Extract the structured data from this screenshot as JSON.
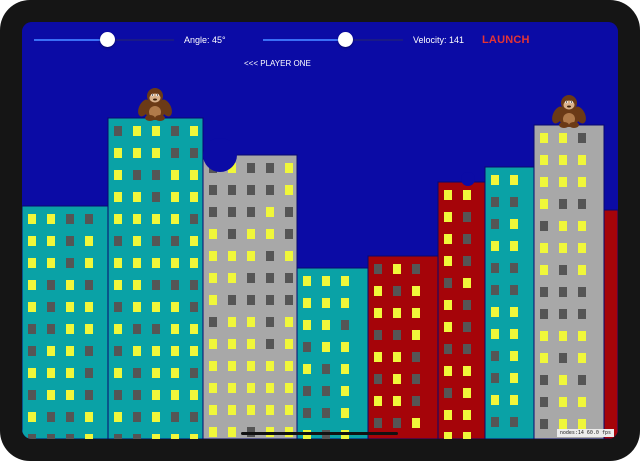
{
  "controls": {
    "angle_label": "Angle: 45°",
    "angle_fraction": 0.41,
    "velocity_label": "Velocity: 141",
    "velocity_fraction": 0.46,
    "launch_label": "LAUNCH"
  },
  "turn_indicator": "<<< PLAYER ONE",
  "debug_stats": "nodes:14  60.0 fps",
  "colors": {
    "sky": "#0b0ba5",
    "teal": "#0aa2a6",
    "gray": "#a8a8a8",
    "red": "#a50409",
    "window_lit": "#f0f73a",
    "window_dark": "#555555",
    "launch": "#e53434",
    "slider_fill": "#3a6ff7"
  },
  "buildings": [
    {
      "color": "teal",
      "lit_pattern": "mixed"
    },
    {
      "color": "teal",
      "lit_pattern": "mixed"
    },
    {
      "color": "gray",
      "lit_pattern": "mixed"
    },
    {
      "color": "teal",
      "lit_pattern": "mixed"
    },
    {
      "color": "red",
      "lit_pattern": "mixed"
    },
    {
      "color": "red",
      "lit_pattern": "mixed"
    },
    {
      "color": "teal",
      "lit_pattern": "mixed"
    },
    {
      "color": "gray",
      "lit_pattern": "mixed"
    },
    {
      "color": "red",
      "lit_pattern": "mixed"
    }
  ],
  "players": [
    {
      "sprite": "gorilla-icon",
      "role": "player-one"
    },
    {
      "sprite": "gorilla-icon",
      "role": "player-two"
    }
  ]
}
